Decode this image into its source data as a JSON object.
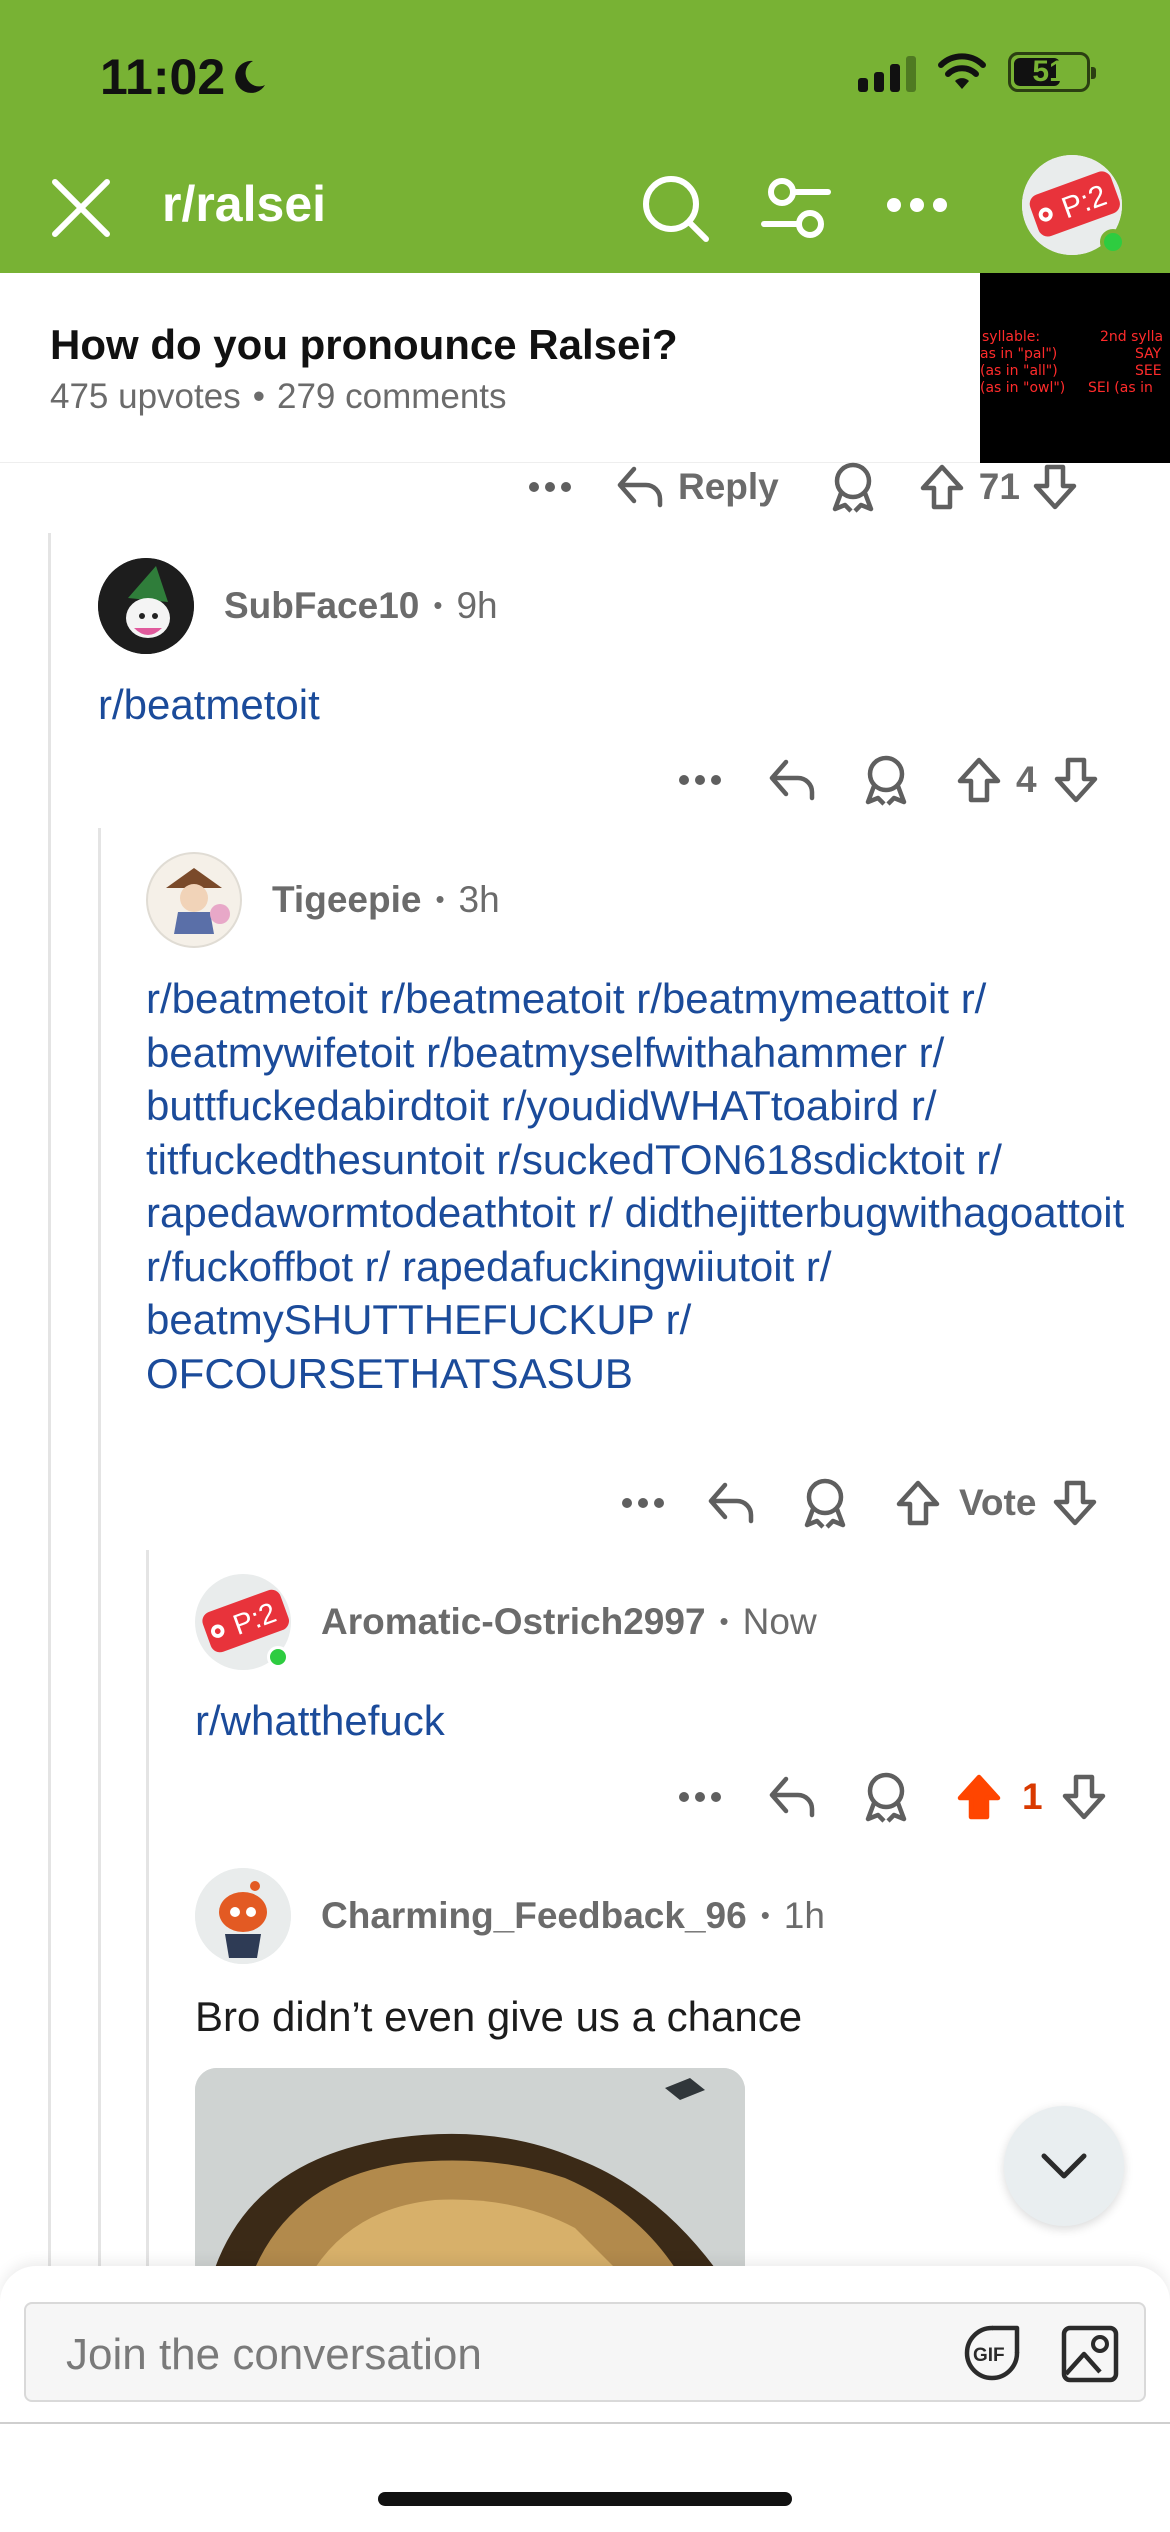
{
  "status_bar": {
    "time": "11:02",
    "battery": "51"
  },
  "header": {
    "subreddit": "r/ralsei"
  },
  "post": {
    "title": "How do you pronounce Ralsei?",
    "upvotes": "475 upvotes",
    "comments": "279 comments",
    "thumbnail_text": [
      "syllable:",
      "2nd sylla",
      "as in \"pal\")",
      "SAY",
      "(as in \"all\")",
      "SEE",
      "(as in \"owl\")",
      "SEI (as in"
    ]
  },
  "top_actions": {
    "reply_label": "Reply",
    "score": "71"
  },
  "comments": [
    {
      "user": "SubFace10",
      "time": "9h",
      "body": "r/beatmetoit",
      "score": "4"
    },
    {
      "user": "Tigeepie",
      "time": "3h",
      "body": "r/beatmetoit r/beatmeatoit r/beatmymeattoit r/ beatmywifetoit r/beatmyselfwithahammer r/ buttfuckedabirdtoit r/youdidWHATtoabird r/ titfuckedthesuntoit r/suckedTON618sdicktoit r/ rapedawormtodeathtoit r/ didthejitterbugwithagoattoit r/fuckoffbot r/ rapedafuckingwiiutoit r/ beatmySHUTTHEFUCKUP r/ OFCOURSETHATSASUB",
      "vote_label": "Vote"
    },
    {
      "user": "Aromatic-Ostrich2997",
      "time": "Now",
      "body": "r/whatthefuck",
      "score": "1"
    },
    {
      "user": "Charming_Feedback_96",
      "time": "1h",
      "body": "Bro didn’t even give us a chance"
    }
  ],
  "composer": {
    "placeholder": "Join the conversation"
  },
  "colors": {
    "header_green": "#78b234",
    "link_blue": "#1b4b9a",
    "upvote_orange": "#ff4500"
  },
  "icons": [
    "close-icon",
    "search-icon",
    "filter-icon",
    "more-icon",
    "reply-icon",
    "award-icon",
    "upvote-icon",
    "downvote-icon",
    "gif-icon",
    "image-icon",
    "chevron-down-icon"
  ]
}
